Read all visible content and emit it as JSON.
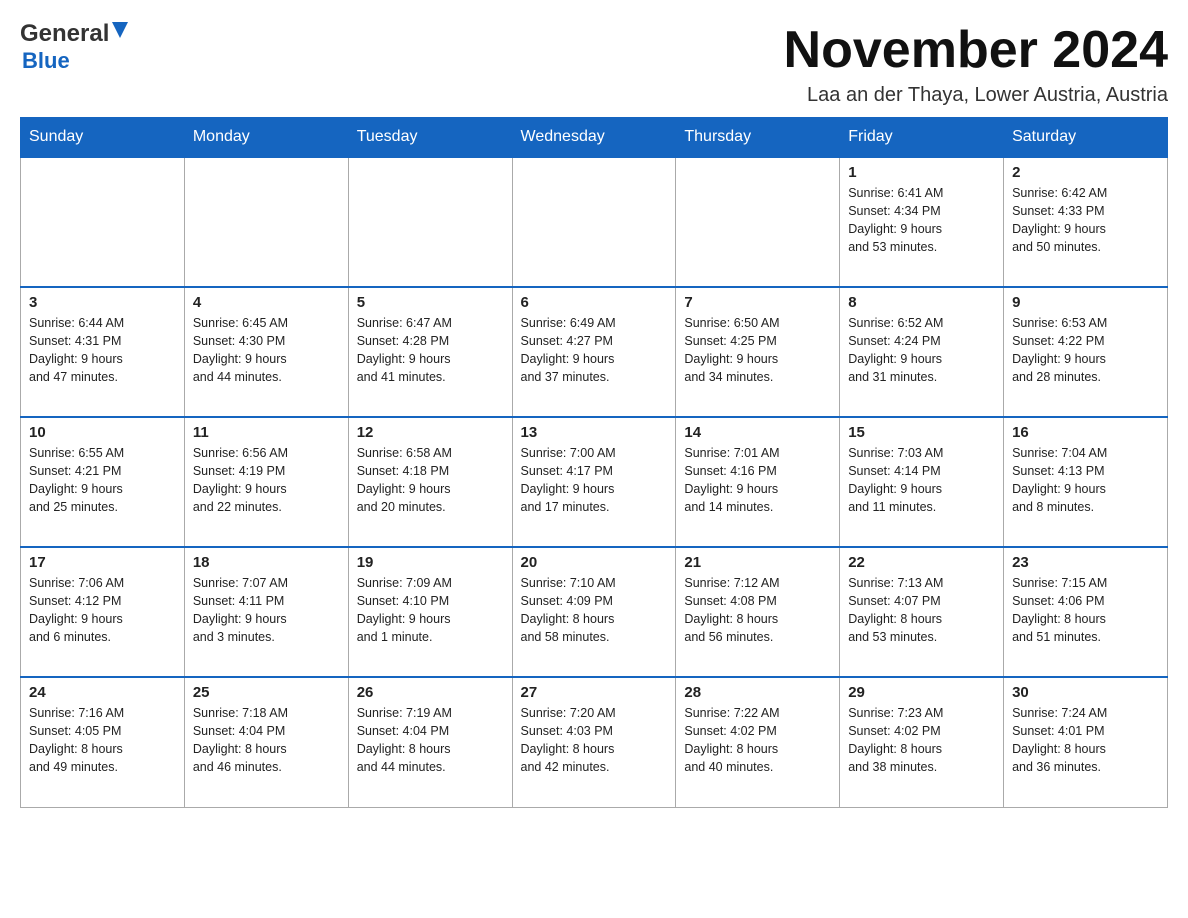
{
  "header": {
    "logo_text_general": "General",
    "logo_text_blue": "Blue",
    "month_title": "November 2024",
    "location": "Laa an der Thaya, Lower Austria, Austria"
  },
  "weekdays": [
    "Sunday",
    "Monday",
    "Tuesday",
    "Wednesday",
    "Thursday",
    "Friday",
    "Saturday"
  ],
  "weeks": [
    [
      {
        "day": "",
        "info": ""
      },
      {
        "day": "",
        "info": ""
      },
      {
        "day": "",
        "info": ""
      },
      {
        "day": "",
        "info": ""
      },
      {
        "day": "",
        "info": ""
      },
      {
        "day": "1",
        "info": "Sunrise: 6:41 AM\nSunset: 4:34 PM\nDaylight: 9 hours\nand 53 minutes."
      },
      {
        "day": "2",
        "info": "Sunrise: 6:42 AM\nSunset: 4:33 PM\nDaylight: 9 hours\nand 50 minutes."
      }
    ],
    [
      {
        "day": "3",
        "info": "Sunrise: 6:44 AM\nSunset: 4:31 PM\nDaylight: 9 hours\nand 47 minutes."
      },
      {
        "day": "4",
        "info": "Sunrise: 6:45 AM\nSunset: 4:30 PM\nDaylight: 9 hours\nand 44 minutes."
      },
      {
        "day": "5",
        "info": "Sunrise: 6:47 AM\nSunset: 4:28 PM\nDaylight: 9 hours\nand 41 minutes."
      },
      {
        "day": "6",
        "info": "Sunrise: 6:49 AM\nSunset: 4:27 PM\nDaylight: 9 hours\nand 37 minutes."
      },
      {
        "day": "7",
        "info": "Sunrise: 6:50 AM\nSunset: 4:25 PM\nDaylight: 9 hours\nand 34 minutes."
      },
      {
        "day": "8",
        "info": "Sunrise: 6:52 AM\nSunset: 4:24 PM\nDaylight: 9 hours\nand 31 minutes."
      },
      {
        "day": "9",
        "info": "Sunrise: 6:53 AM\nSunset: 4:22 PM\nDaylight: 9 hours\nand 28 minutes."
      }
    ],
    [
      {
        "day": "10",
        "info": "Sunrise: 6:55 AM\nSunset: 4:21 PM\nDaylight: 9 hours\nand 25 minutes."
      },
      {
        "day": "11",
        "info": "Sunrise: 6:56 AM\nSunset: 4:19 PM\nDaylight: 9 hours\nand 22 minutes."
      },
      {
        "day": "12",
        "info": "Sunrise: 6:58 AM\nSunset: 4:18 PM\nDaylight: 9 hours\nand 20 minutes."
      },
      {
        "day": "13",
        "info": "Sunrise: 7:00 AM\nSunset: 4:17 PM\nDaylight: 9 hours\nand 17 minutes."
      },
      {
        "day": "14",
        "info": "Sunrise: 7:01 AM\nSunset: 4:16 PM\nDaylight: 9 hours\nand 14 minutes."
      },
      {
        "day": "15",
        "info": "Sunrise: 7:03 AM\nSunset: 4:14 PM\nDaylight: 9 hours\nand 11 minutes."
      },
      {
        "day": "16",
        "info": "Sunrise: 7:04 AM\nSunset: 4:13 PM\nDaylight: 9 hours\nand 8 minutes."
      }
    ],
    [
      {
        "day": "17",
        "info": "Sunrise: 7:06 AM\nSunset: 4:12 PM\nDaylight: 9 hours\nand 6 minutes."
      },
      {
        "day": "18",
        "info": "Sunrise: 7:07 AM\nSunset: 4:11 PM\nDaylight: 9 hours\nand 3 minutes."
      },
      {
        "day": "19",
        "info": "Sunrise: 7:09 AM\nSunset: 4:10 PM\nDaylight: 9 hours\nand 1 minute."
      },
      {
        "day": "20",
        "info": "Sunrise: 7:10 AM\nSunset: 4:09 PM\nDaylight: 8 hours\nand 58 minutes."
      },
      {
        "day": "21",
        "info": "Sunrise: 7:12 AM\nSunset: 4:08 PM\nDaylight: 8 hours\nand 56 minutes."
      },
      {
        "day": "22",
        "info": "Sunrise: 7:13 AM\nSunset: 4:07 PM\nDaylight: 8 hours\nand 53 minutes."
      },
      {
        "day": "23",
        "info": "Sunrise: 7:15 AM\nSunset: 4:06 PM\nDaylight: 8 hours\nand 51 minutes."
      }
    ],
    [
      {
        "day": "24",
        "info": "Sunrise: 7:16 AM\nSunset: 4:05 PM\nDaylight: 8 hours\nand 49 minutes."
      },
      {
        "day": "25",
        "info": "Sunrise: 7:18 AM\nSunset: 4:04 PM\nDaylight: 8 hours\nand 46 minutes."
      },
      {
        "day": "26",
        "info": "Sunrise: 7:19 AM\nSunset: 4:04 PM\nDaylight: 8 hours\nand 44 minutes."
      },
      {
        "day": "27",
        "info": "Sunrise: 7:20 AM\nSunset: 4:03 PM\nDaylight: 8 hours\nand 42 minutes."
      },
      {
        "day": "28",
        "info": "Sunrise: 7:22 AM\nSunset: 4:02 PM\nDaylight: 8 hours\nand 40 minutes."
      },
      {
        "day": "29",
        "info": "Sunrise: 7:23 AM\nSunset: 4:02 PM\nDaylight: 8 hours\nand 38 minutes."
      },
      {
        "day": "30",
        "info": "Sunrise: 7:24 AM\nSunset: 4:01 PM\nDaylight: 8 hours\nand 36 minutes."
      }
    ]
  ]
}
